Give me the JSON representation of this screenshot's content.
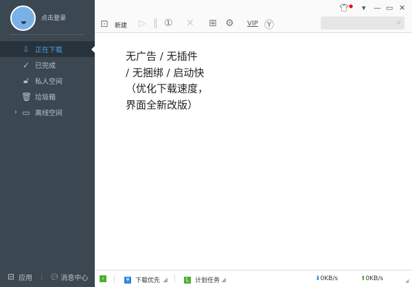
{
  "sidebar": {
    "login": "点击登录",
    "items": [
      {
        "label": "正在下载",
        "icon": "download-icon"
      },
      {
        "label": "已完成",
        "icon": "check-circle-icon"
      },
      {
        "label": "私人空间",
        "icon": "lock-icon"
      },
      {
        "label": "垃圾箱",
        "icon": "trash-icon"
      },
      {
        "label": "离线空间",
        "icon": "cloud-download-icon"
      }
    ],
    "footer": {
      "apps": "应用",
      "messages": "消息中心"
    }
  },
  "toolbar": {
    "new": "新建",
    "vip": "VIP"
  },
  "content": {
    "lines": [
      "无广告 / 无插件",
      "/ 无捆绑 / 启动快",
      "（优化下载速度，",
      "界面全新改版）"
    ]
  },
  "status": {
    "priority": "下载优先",
    "schedule": "计划任务",
    "down_speed": "0KB/s",
    "up_speed": "0KB/s"
  },
  "colors": {
    "sidebar": "#3b4852",
    "accent": "#4a9de8",
    "green": "#4caf2f"
  }
}
